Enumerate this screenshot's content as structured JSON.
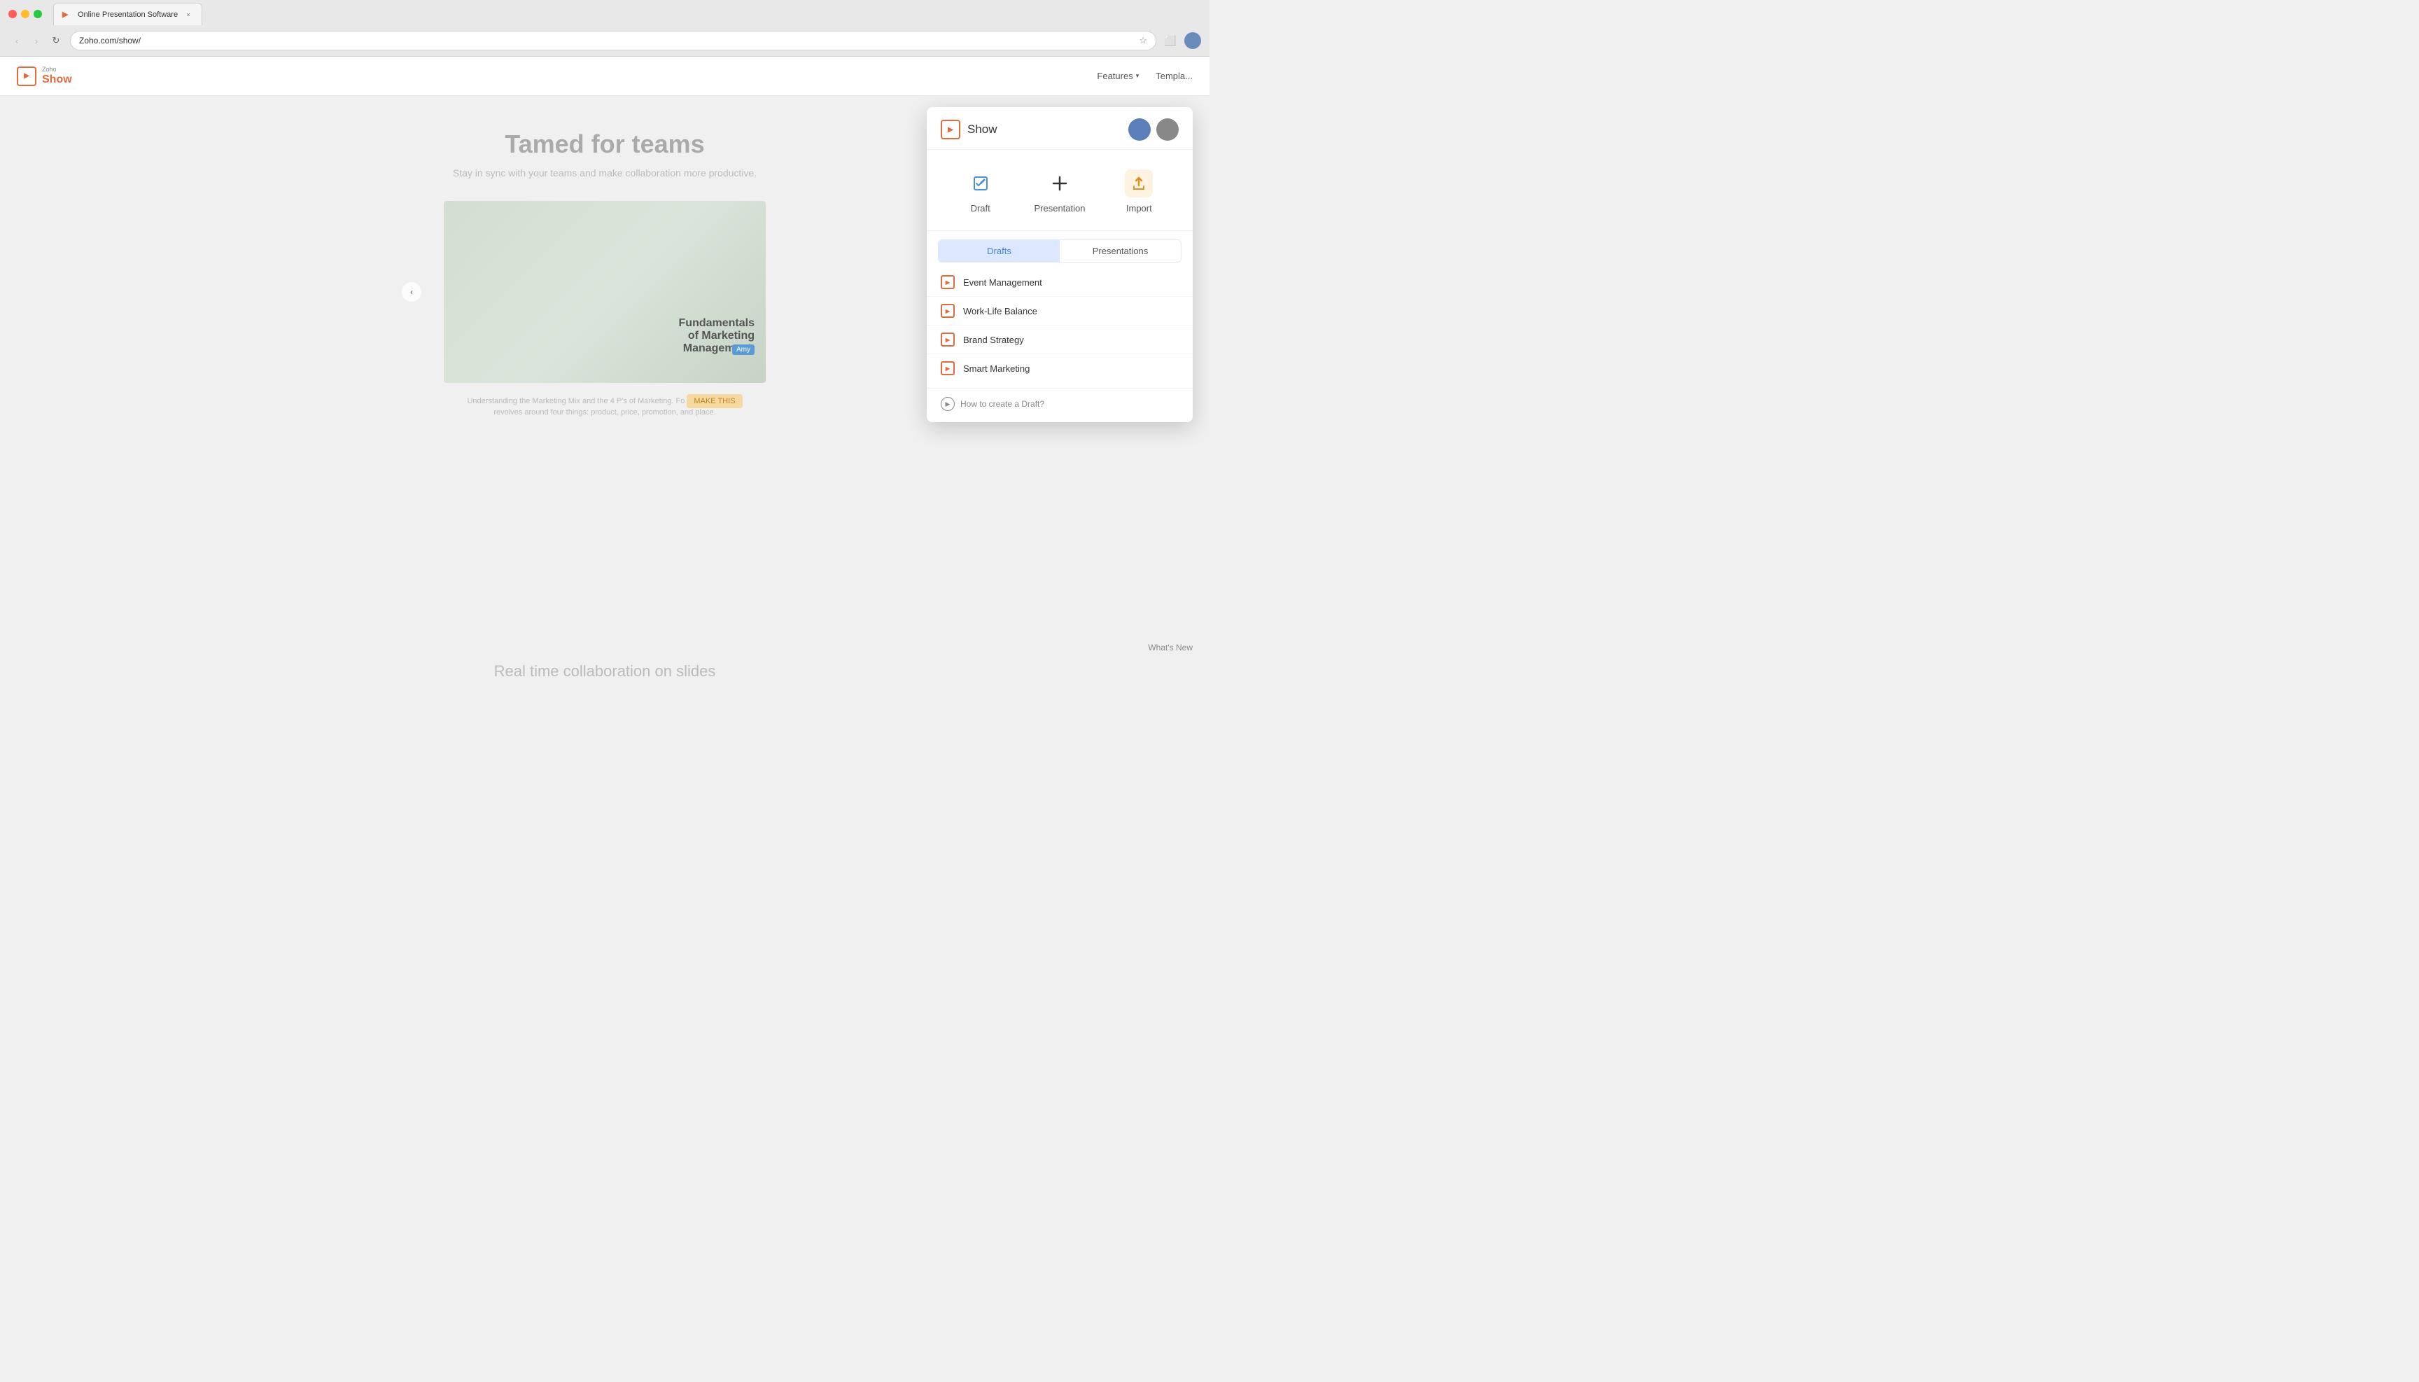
{
  "browser": {
    "traffic_lights": [
      "red",
      "yellow",
      "green"
    ],
    "tab": {
      "favicon": "▶",
      "title": "Online Presentation Software",
      "close": "×"
    },
    "nav": {
      "back": "‹",
      "forward": "›",
      "refresh": "↻"
    },
    "address": "Zoho.com/show/",
    "bookmark_icon": "☆",
    "toolbar_icons": [
      "extensions",
      "profile"
    ],
    "extensions_icon": "⬜",
    "profile_icon": "👤"
  },
  "site_nav": {
    "logo_zoho": "Zoho",
    "logo_show": "Show",
    "links": [
      {
        "label": "Features",
        "has_arrow": true
      },
      {
        "label": "Templa..."
      }
    ]
  },
  "hero": {
    "title": "Tamed for teams",
    "subtitle": "Stay in sync with your teams and make collaboration more productive.",
    "slide_text": [
      "Fundamentals",
      "of Marketing",
      "Management."
    ],
    "avatar_badge": "Amy",
    "bottom_text": "Understanding the Marketing Mix and the 4 P's of Marketing. Fo",
    "bottom_text2": "revolves around four things: product, price, promotion, and place.",
    "make_this_label": "MAKE THIS",
    "section_title": "Real time collaboration on slides"
  },
  "whats_new": {
    "label": "What's New"
  },
  "popup": {
    "title": "Show",
    "actions": {
      "draft": {
        "label": "Draft",
        "icon": "✏"
      },
      "presentation": {
        "label": "Presentation",
        "icon": "+"
      },
      "import": {
        "label": "Import",
        "icon": "↑"
      }
    },
    "tabs": [
      {
        "label": "Drafts",
        "active": true
      },
      {
        "label": "Presentations",
        "active": false
      }
    ],
    "drafts": [
      {
        "name": "Event Management"
      },
      {
        "name": "Work-Life Balance"
      },
      {
        "name": "Brand Strategy"
      },
      {
        "name": "Smart Marketing"
      }
    ],
    "footer": {
      "label": "How to create a Draft?"
    }
  }
}
